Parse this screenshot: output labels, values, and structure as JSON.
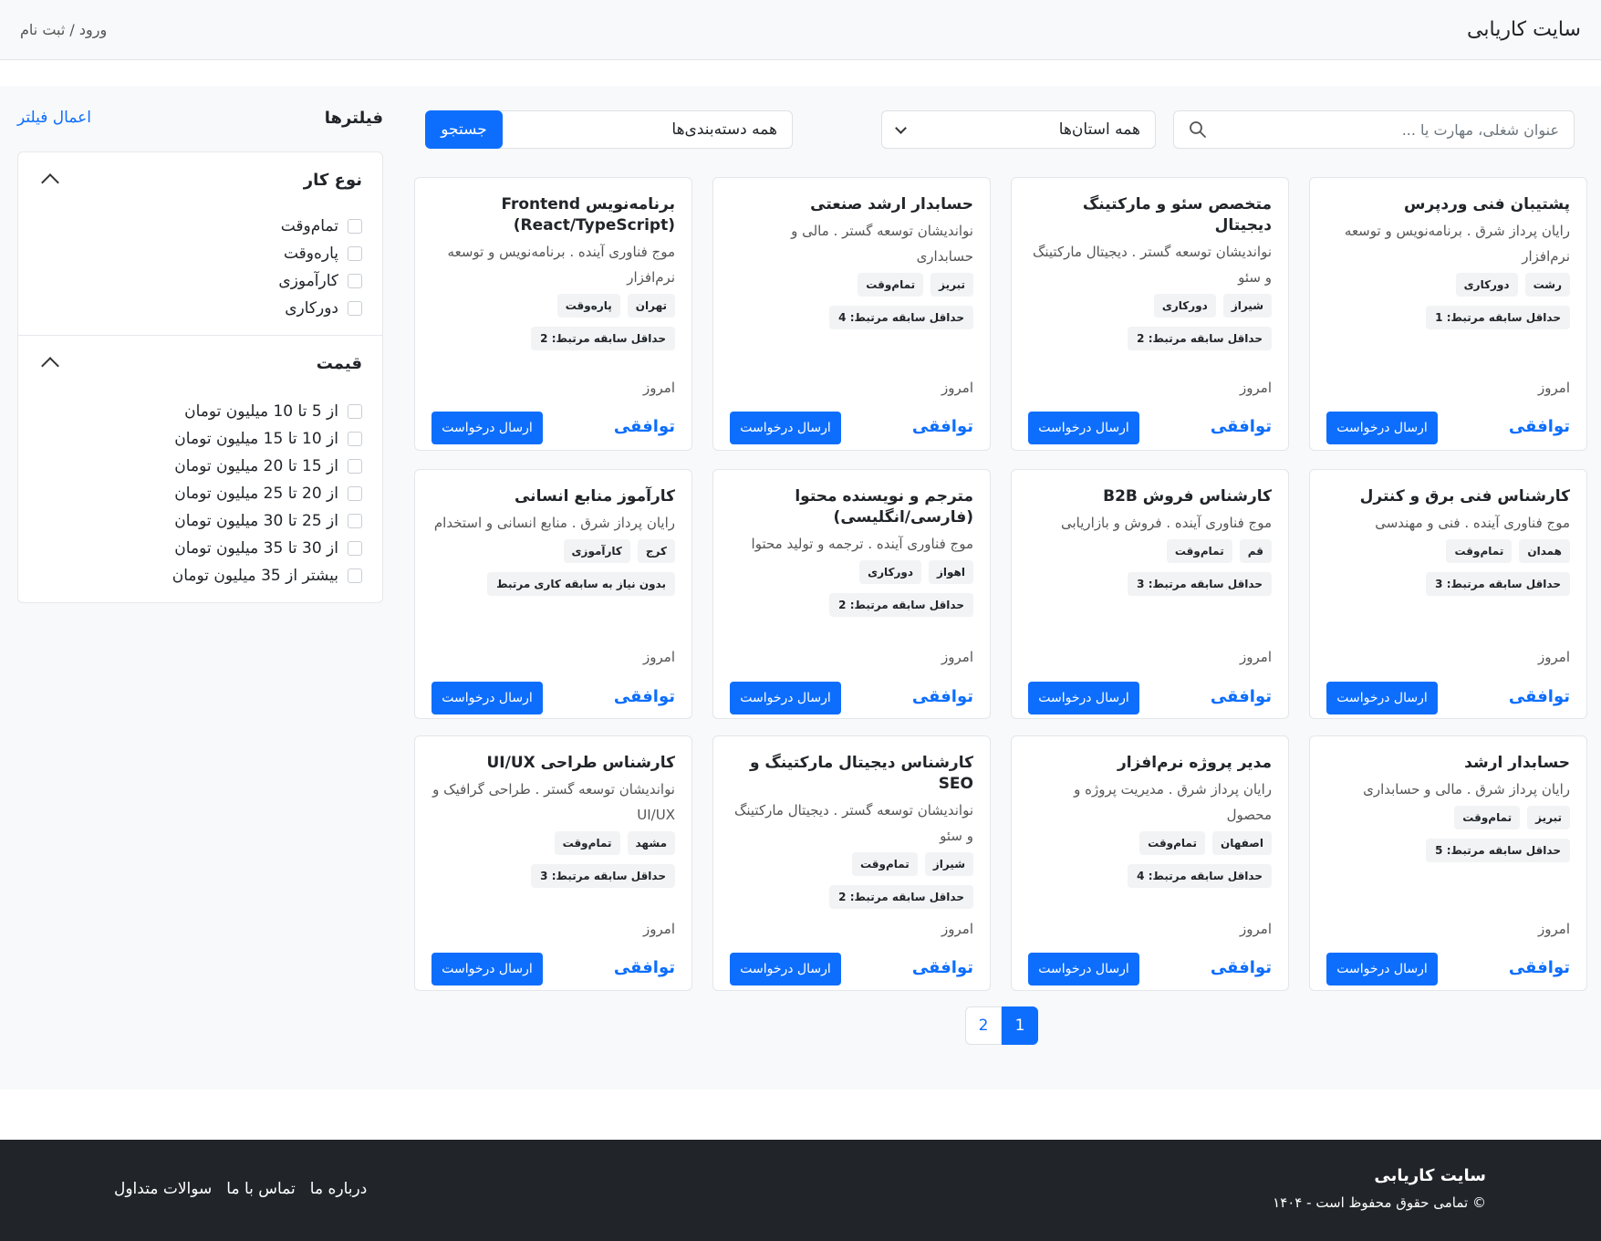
{
  "header": {
    "brand": "سایت کاریابی",
    "auth_link": "ورود / ثبت نام"
  },
  "search": {
    "placeholder": "عنوان شغلی، مهارت یا ...",
    "province_select": "همه استان‌ها",
    "category_select": "همه دسته‌بندی‌ها",
    "button": "جستجو"
  },
  "sidebar": {
    "title": "فیلترها",
    "apply": "اعمال فیلتر",
    "job_type": {
      "title": "نوع کار",
      "options": [
        "تمام‌وقت",
        "پاره‌وقت",
        "کارآموزی",
        "دورکاری"
      ]
    },
    "price": {
      "title": "قیمت",
      "options": [
        "از 5 تا 10 میلیون تومان",
        "از 10 تا 15 میلیون تومان",
        "از 15 تا 20 میلیون تومان",
        "از 20 تا 25 میلیون تومان",
        "از 25 تا 30 میلیون تومان",
        "از 30 تا 35 میلیون تومان",
        "بیشتر از 35 میلیون تومان"
      ]
    }
  },
  "jobs": [
    {
      "title": "پشتیبان فنی وردپرس",
      "company": "رایان پرداز شرق . برنامه‌نویس و توسعه نرم‌افزار",
      "city": "رشت",
      "type": "دورکاری",
      "experience": "حداقل سابقه مرتبط: 1",
      "date": "امروز",
      "salary": "توافقی",
      "apply": "ارسال درخواست"
    },
    {
      "title": "متخصص سئو و مارکتینگ دیجیتال",
      "company": "نواندیشان توسعه گستر . دیجیتال مارکتینگ و سئو",
      "city": "شیراز",
      "type": "دورکاری",
      "experience": "حداقل سابقه مرتبط: 2",
      "date": "امروز",
      "salary": "توافقی",
      "apply": "ارسال درخواست"
    },
    {
      "title": "حسابدار ارشد صنعتی",
      "company": "نواندیشان توسعه گستر . مالی و حسابداری",
      "city": "تبریز",
      "type": "تمام‌وقت",
      "experience": "حداقل سابقه مرتبط: 4",
      "date": "امروز",
      "salary": "توافقی",
      "apply": "ارسال درخواست"
    },
    {
      "title": "برنامه‌نویس Frontend (React/TypeScript)",
      "company": "موج فناوری آینده . برنامه‌نویس و توسعه نرم‌افزار",
      "city": "تهران",
      "type": "پاره‌وقت",
      "experience": "حداقل سابقه مرتبط: 2",
      "date": "امروز",
      "salary": "توافقی",
      "apply": "ارسال درخواست"
    },
    {
      "title": "کارشناس فنی برق و کنترل",
      "company": "موج فناوری آینده . فنی و مهندسی",
      "city": "همدان",
      "type": "تمام‌وقت",
      "experience": "حداقل سابقه مرتبط: 3",
      "date": "امروز",
      "salary": "توافقی",
      "apply": "ارسال درخواست"
    },
    {
      "title": "کارشناس فروش B2B",
      "company": "موج فناوری آینده . فروش و بازاریابی",
      "city": "قم",
      "type": "تمام‌وقت",
      "experience": "حداقل سابقه مرتبط: 3",
      "date": "امروز",
      "salary": "توافقی",
      "apply": "ارسال درخواست"
    },
    {
      "title": "مترجم و نویسنده محتوا (فارسی/انگلیسی)",
      "company": "موج فناوری آینده . ترجمه و تولید محتوا",
      "city": "اهواز",
      "type": "دورکاری",
      "experience": "حداقل سابقه مرتبط: 2",
      "date": "امروز",
      "salary": "توافقی",
      "apply": "ارسال درخواست"
    },
    {
      "title": "کارآموز منابع انسانی",
      "company": "رایان پرداز شرق . منابع انسانی و استخدام",
      "city": "کرج",
      "type": "کارآموزی",
      "experience": "بدون نیاز به سابقه کاری مرتبط",
      "date": "امروز",
      "salary": "توافقی",
      "apply": "ارسال درخواست"
    },
    {
      "title": "حسابدار ارشد",
      "company": "رایان پرداز شرق . مالی و حسابداری",
      "city": "تبریز",
      "type": "تمام‌وقت",
      "experience": "حداقل سابقه مرتبط: 5",
      "date": "امروز",
      "salary": "توافقی",
      "apply": "ارسال درخواست"
    },
    {
      "title": "مدیر پروژه نرم‌افزار",
      "company": "رایان پرداز شرق . مدیریت پروژه و محصول",
      "city": "اصفهان",
      "type": "تمام‌وقت",
      "experience": "حداقل سابقه مرتبط: 4",
      "date": "امروز",
      "salary": "توافقی",
      "apply": "ارسال درخواست"
    },
    {
      "title": "کارشناس دیجیتال مارکتینگ و SEO",
      "company": "نواندیشان توسعه گستر . دیجیتال مارکتینگ و سئو",
      "city": "شیراز",
      "type": "تمام‌وقت",
      "experience": "حداقل سابقه مرتبط: 2",
      "date": "امروز",
      "salary": "توافقی",
      "apply": "ارسال درخواست"
    },
    {
      "title": "کارشناس طراحی UI/UX",
      "company": "نواندیشان توسعه گستر . طراحی گرافیک و UI/UX",
      "city": "مشهد",
      "type": "تمام‌وقت",
      "experience": "حداقل سابقه مرتبط: 3",
      "date": "امروز",
      "salary": "توافقی",
      "apply": "ارسال درخواست"
    }
  ],
  "pagination": {
    "pages": [
      "1",
      "2"
    ],
    "current": "1"
  },
  "footer": {
    "brand": "سایت کاریابی",
    "copyright": "© تمامی حقوق محفوظ است - ۱۴۰۴",
    "links": [
      "درباره ما",
      "تماس با ما",
      "سوالات متداول"
    ]
  },
  "colors": {
    "accent": "#0d6efd",
    "footer_bg": "#212529",
    "page_bg": "#f8f9fa"
  }
}
